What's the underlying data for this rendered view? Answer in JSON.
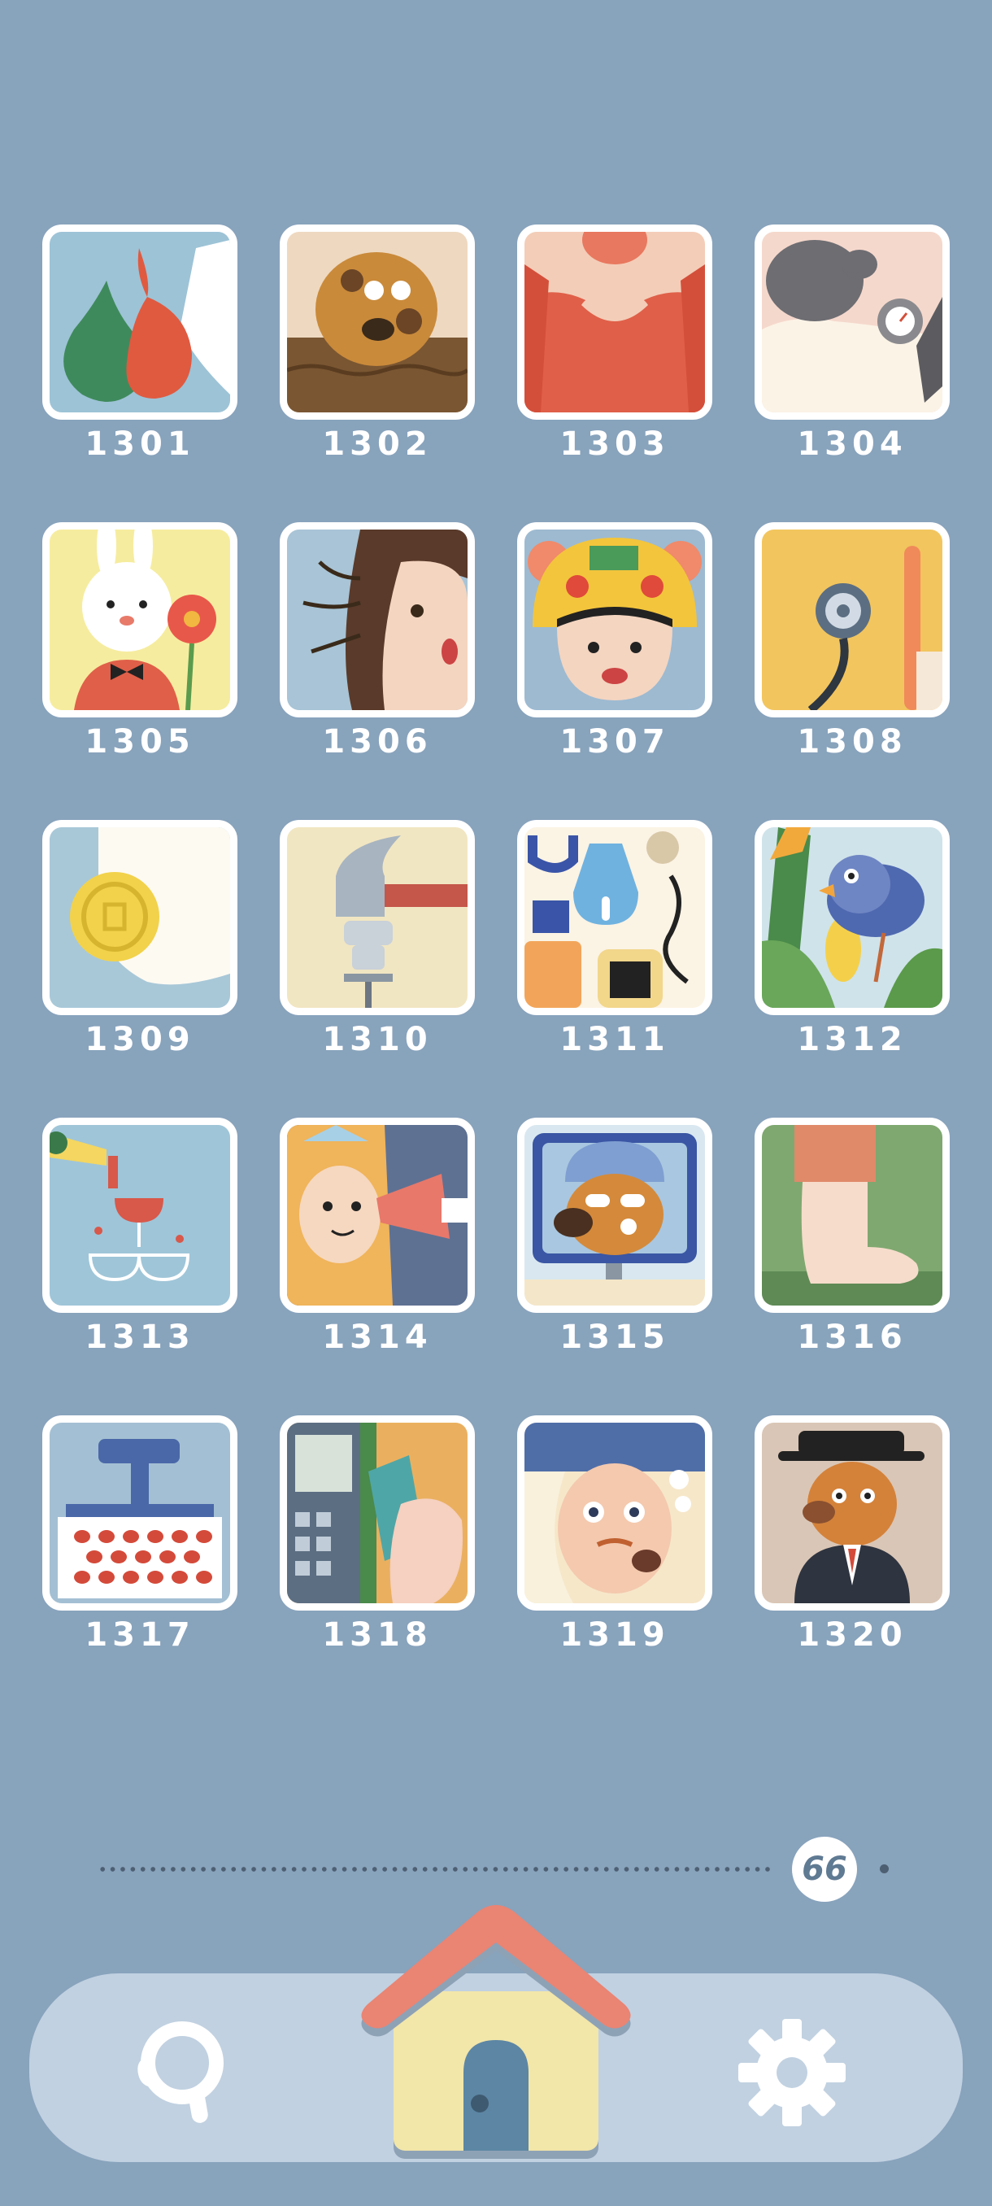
{
  "levels": [
    {
      "id": "1301",
      "label": "1301",
      "scene": "dumpling-bags"
    },
    {
      "id": "1302",
      "label": "1302",
      "scene": "dog-in-mud"
    },
    {
      "id": "1303",
      "label": "1303",
      "scene": "heart-hands"
    },
    {
      "id": "1304",
      "label": "1304",
      "scene": "rice-cooker-gauge"
    },
    {
      "id": "1305",
      "label": "1305",
      "scene": "bunny-with-flower"
    },
    {
      "id": "1306",
      "label": "1306",
      "scene": "girl-windblown-hair"
    },
    {
      "id": "1307",
      "label": "1307",
      "scene": "tiger-hat-child"
    },
    {
      "id": "1308",
      "label": "1308",
      "scene": "stethoscope"
    },
    {
      "id": "1309",
      "label": "1309",
      "scene": "coin-in-dumpling"
    },
    {
      "id": "1310",
      "label": "1310",
      "scene": "hammer-and-nail"
    },
    {
      "id": "1311",
      "label": "1311",
      "scene": "household-objects"
    },
    {
      "id": "1312",
      "label": "1312",
      "scene": "bird-eating-corn"
    },
    {
      "id": "1313",
      "label": "1313",
      "scene": "champagne-tower"
    },
    {
      "id": "1314",
      "label": "1314",
      "scene": "princess-megaphone"
    },
    {
      "id": "1315",
      "label": "1315",
      "scene": "dog-brushing-teeth"
    },
    {
      "id": "1316",
      "label": "1316",
      "scene": "bare-foot"
    },
    {
      "id": "1317",
      "label": "1317",
      "scene": "seed-press"
    },
    {
      "id": "1318",
      "label": "1318",
      "scene": "card-payment"
    },
    {
      "id": "1319",
      "label": "1319",
      "scene": "man-with-pipe"
    },
    {
      "id": "1320",
      "label": "1320",
      "scene": "dog-in-suit"
    }
  ],
  "progress": {
    "page_number": "66"
  },
  "nav": {
    "hint_icon": "magnifier-icon",
    "home_icon": "house-icon",
    "settings_icon": "gear-icon"
  },
  "colors": {
    "background": "#88a3bc",
    "bar": "#c1d1e1",
    "roof": "#ea8473",
    "house": "#f2e6a9",
    "door": "#5c86a4"
  }
}
